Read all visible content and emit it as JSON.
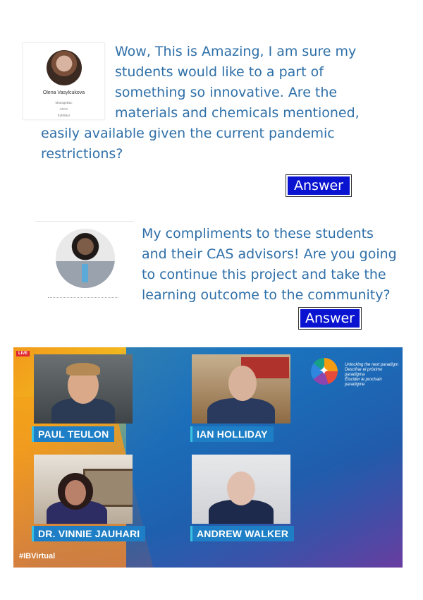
{
  "question1": {
    "author_name": "Olena Vasylcukova",
    "org": "ManageBac",
    "region": "APAC",
    "role": "Exhibitor",
    "lines": [
      "Wow, This is Amazing, I am sure my",
      "students would like to a part of",
      "something so innovative. Are the",
      "materials and chemicals mentioned,",
      "easily available given the current pandemic",
      "restrictions?"
    ],
    "answer_label": "Answer"
  },
  "question2": {
    "lines": [
      "My compliments to these students",
      "and their CAS advisors! Are you going",
      "to continue this project and take the",
      "learning outcome to the community?"
    ],
    "answer_label": "Answer"
  },
  "video_panel": {
    "live_badge": "LIVE",
    "tagline": [
      "Unlocking the next paradigm",
      "Descifrar el próximo paradigma",
      "Élucider le prochain paradigme"
    ],
    "hashtag": "#IBVirtual",
    "speakers": [
      "PAUL TEULON",
      "IAN HOLLIDAY",
      "DR. VINNIE JAUHARI",
      "ANDREW WALKER"
    ],
    "colors": {
      "blue": "#1e7fc6",
      "orange": "#f29a1b",
      "purple": "#7a3da0",
      "live": "#e0262e"
    }
  }
}
